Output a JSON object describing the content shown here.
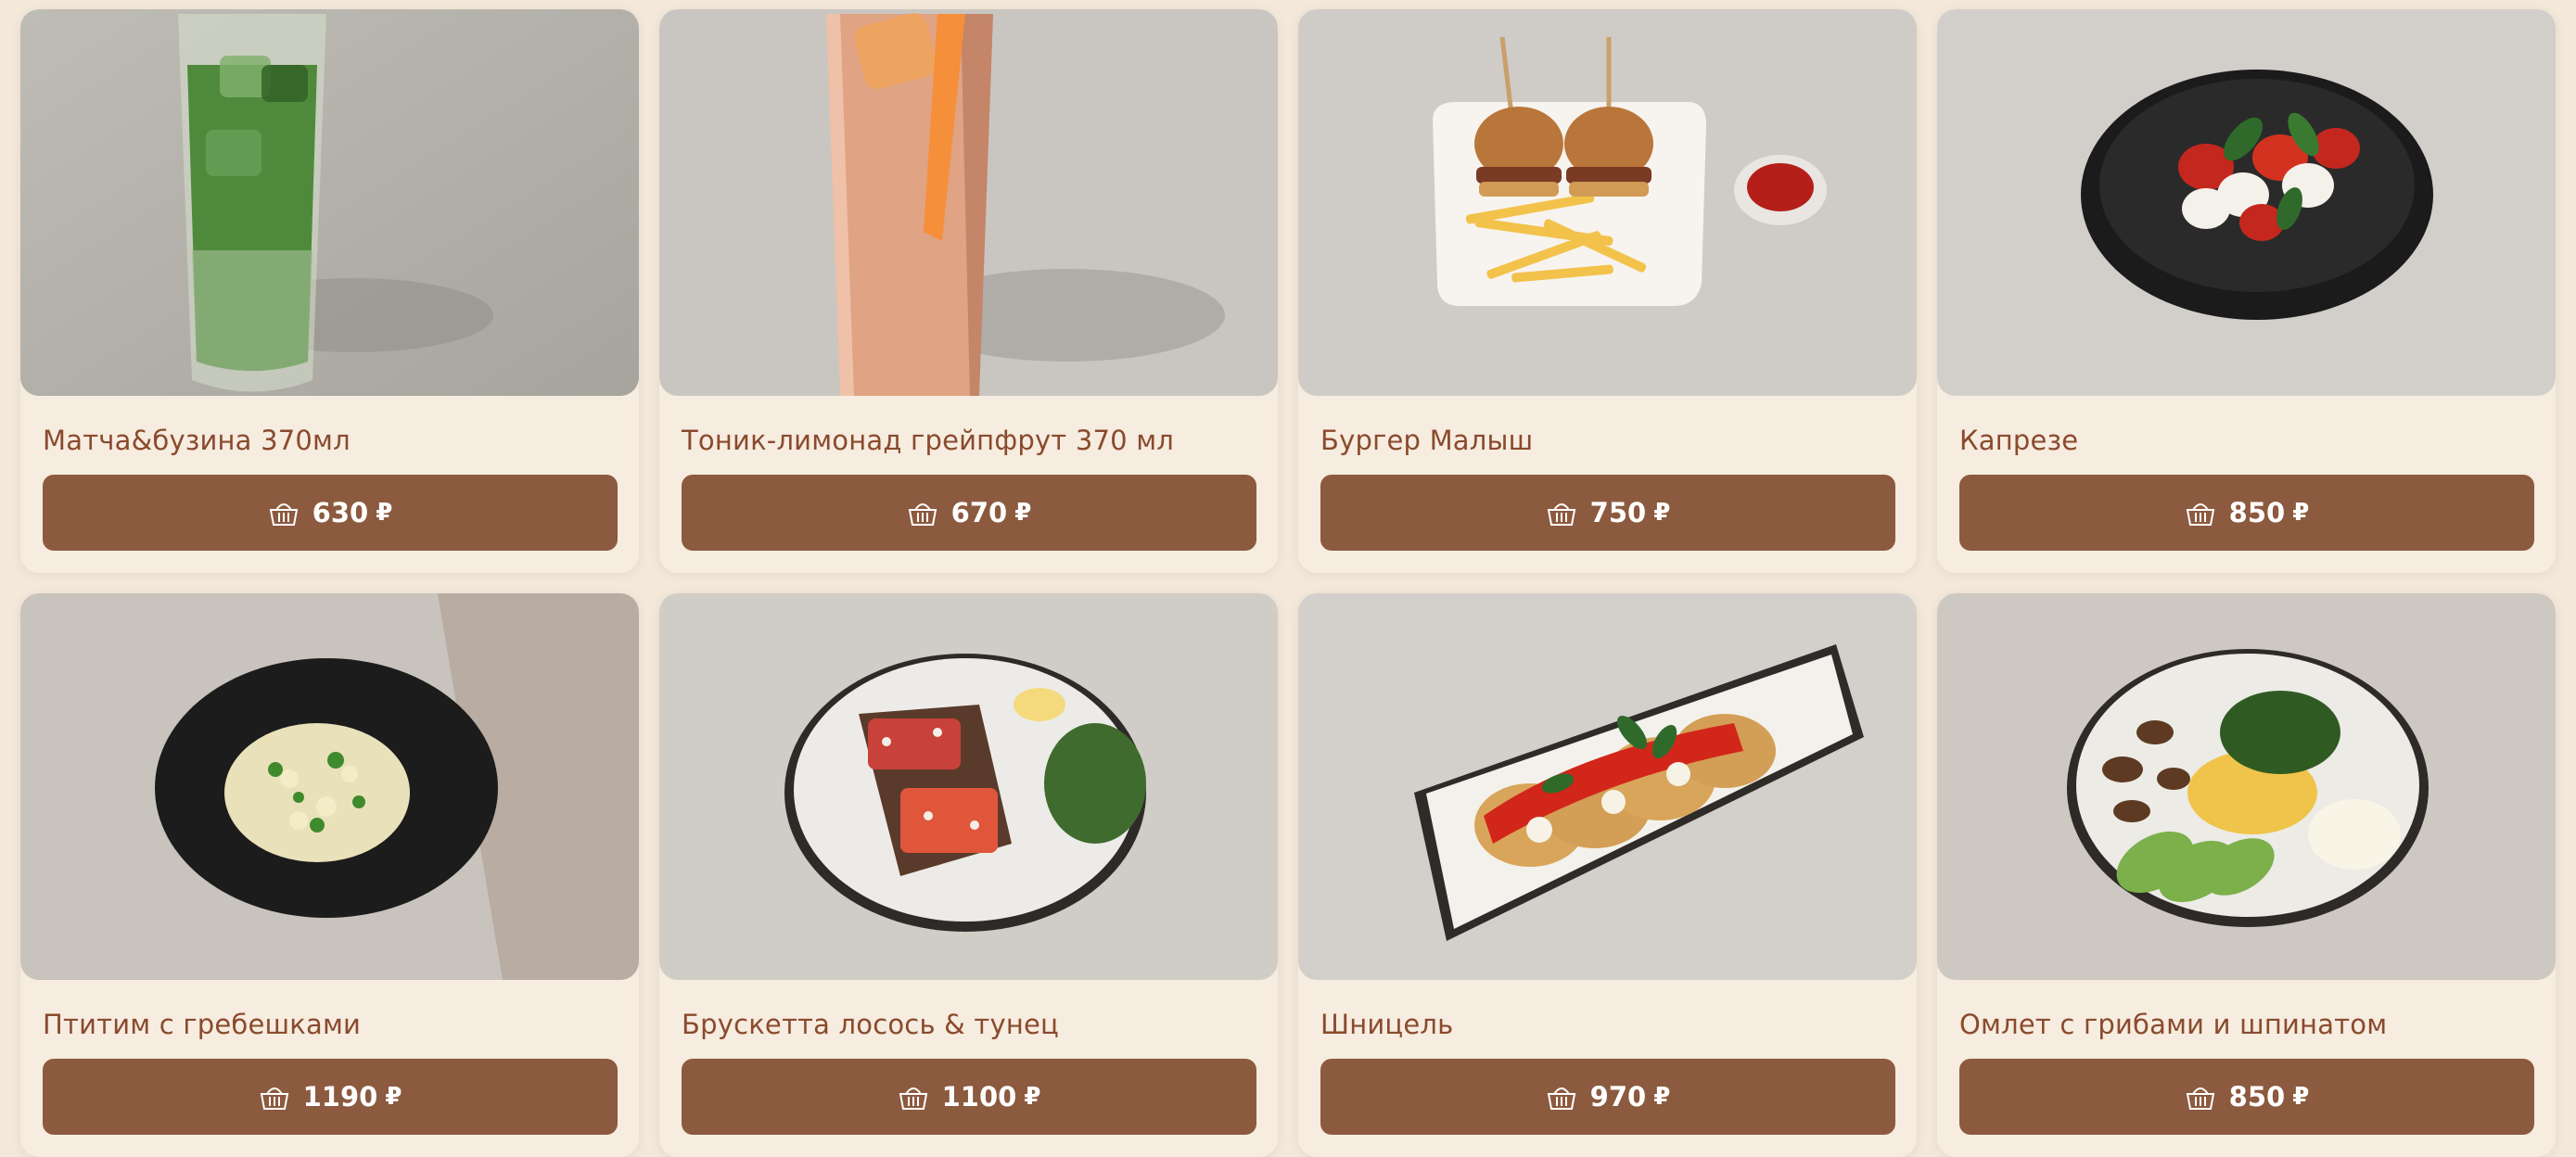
{
  "menu": {
    "items": [
      {
        "name": "Матча&бузина 370мл",
        "price": "630",
        "currency": "₽",
        "photo": "matcha-drink"
      },
      {
        "name": "Тоник-лимонад грейпфрут 370 мл",
        "price": "670",
        "currency": "₽",
        "photo": "grapefruit-lemonade"
      },
      {
        "name": "Бургер Малыш",
        "price": "750",
        "currency": "₽",
        "photo": "mini-burgers"
      },
      {
        "name": "Капрезе",
        "price": "850",
        "currency": "₽",
        "photo": "caprese"
      },
      {
        "name": "Птитим с гребешками",
        "price": "1190",
        "currency": "₽",
        "photo": "ptitim-scallops"
      },
      {
        "name": "Брускетта лосось & тунец",
        "price": "1100",
        "currency": "₽",
        "photo": "bruschetta"
      },
      {
        "name": "Шницель",
        "price": "970",
        "currency": "₽",
        "photo": "schnitzel"
      },
      {
        "name": "Омлет с грибами и шпинатом",
        "price": "850",
        "currency": "₽",
        "photo": "omelette"
      }
    ]
  },
  "colors": {
    "page_bg": "#f3e8da",
    "card_bg": "#f6ecdf",
    "title_text": "#8a4a2d",
    "button_bg": "#8c5a3f",
    "button_text": "#ffffff"
  },
  "icons": {
    "basket": "basket-icon"
  }
}
